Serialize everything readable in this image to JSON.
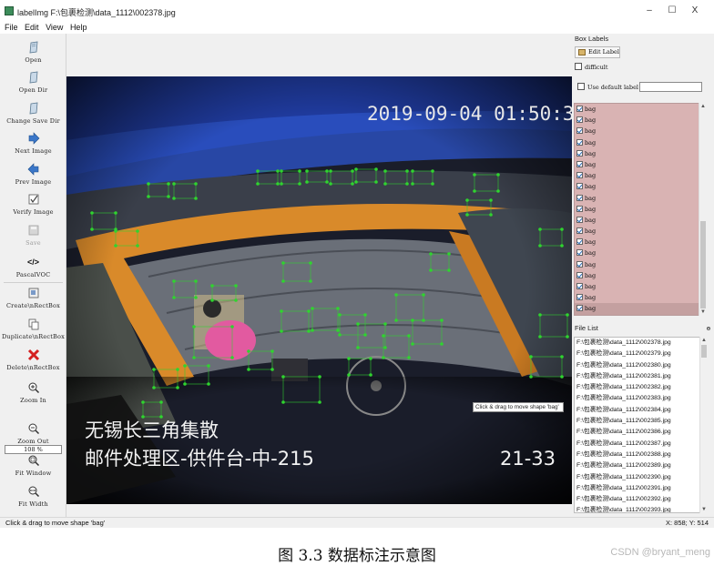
{
  "window": {
    "title": "labelImg F:\\包裹检测\\data_1112\\002378.jpg",
    "minimize": "–",
    "maximize": "☐",
    "close": "X"
  },
  "menu": [
    "File",
    "Edit",
    "View",
    "Help"
  ],
  "toolbar": {
    "open": "Open",
    "open_dir": "Open Dir",
    "change_save_dir": "Change Save Dir",
    "next_image": "Next Image",
    "prev_image": "Prev Image",
    "verify_image": "Verify Image",
    "save": "Save",
    "format_icon": "</>",
    "format": "PascalVOC",
    "create_rectbox": "Create\\nRectBox",
    "duplicate_rectbox": "Duplicate\\nRectBox",
    "delete_rectbox": "Delete\\nRectBox",
    "zoom_in": "Zoom In",
    "zoom_value": "108 %",
    "zoom_out": "Zoom Out",
    "fit_window": "Fit Window",
    "fit_width": "Fit Width"
  },
  "box_labels": {
    "title": "Box Labels",
    "edit_label": "Edit Label",
    "difficult": "difficult",
    "use_default_label": "Use default label",
    "default_label_value": "",
    "labels": [
      "bag",
      "bag",
      "bag",
      "bag",
      "bag",
      "bag",
      "bag",
      "bag",
      "bag",
      "bag",
      "bag",
      "bag",
      "bag",
      "bag",
      "bag",
      "bag",
      "bag",
      "bag",
      "bag"
    ]
  },
  "file_list": {
    "title": "File List",
    "dock_icon": "ɵ",
    "files": [
      "F:\\包裹检测\\data_1112\\002378.jpg",
      "F:\\包裹检测\\data_1112\\002379.jpg",
      "F:\\包裹检测\\data_1112\\002380.jpg",
      "F:\\包裹检测\\data_1112\\002381.jpg",
      "F:\\包裹检测\\data_1112\\002382.jpg",
      "F:\\包裹检测\\data_1112\\002383.jpg",
      "F:\\包裹检测\\data_1112\\002384.jpg",
      "F:\\包裹检测\\data_1112\\002385.jpg",
      "F:\\包裹检测\\data_1112\\002386.jpg",
      "F:\\包裹检测\\data_1112\\002387.jpg",
      "F:\\包裹检测\\data_1112\\002388.jpg",
      "F:\\包裹检测\\data_1112\\002389.jpg",
      "F:\\包裹检测\\data_1112\\002390.jpg",
      "F:\\包裹检测\\data_1112\\002391.jpg",
      "F:\\包裹检测\\data_1112\\002392.jpg",
      "F:\\包裹检测\\data_1112\\002393.jpg"
    ]
  },
  "image_overlay": {
    "timestamp": "2019-09-04 01:50:32",
    "location_line1": "无锡长三角集散",
    "location_line2": "邮件处理区-供件台-中-215",
    "camera_id": "21-33",
    "tooltip": "Click & drag to move shape 'bag'"
  },
  "status": {
    "message": "Click & drag to move shape 'bag'",
    "coords": "X: 858; Y: 514"
  },
  "caption": "图 3.3 数据标注示意图",
  "watermark": "CSDN @bryant_meng",
  "colors": {
    "box": "#2fd42f",
    "label_list_bg": "#d9b3b3",
    "conveyor_orange": "#d98a2a",
    "wall_blue": "#1f3a9c"
  }
}
